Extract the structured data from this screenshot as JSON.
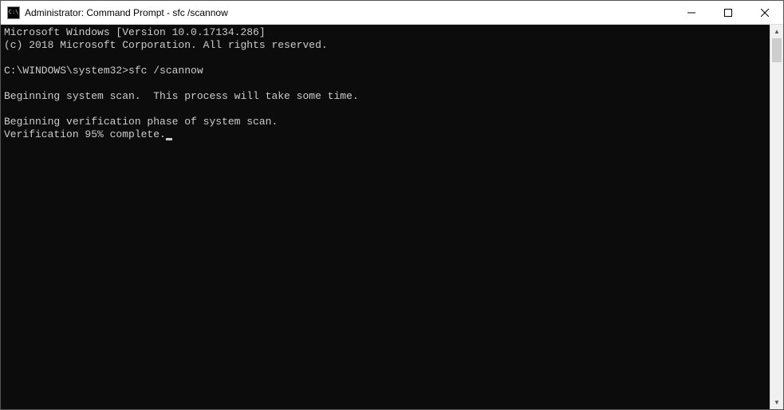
{
  "window": {
    "title": "Administrator: Command Prompt - sfc  /scannow",
    "icon_label": "C:\\"
  },
  "console": {
    "lines": [
      "Microsoft Windows [Version 10.0.17134.286]",
      "(c) 2018 Microsoft Corporation. All rights reserved.",
      "",
      "C:\\WINDOWS\\system32>sfc /scannow",
      "",
      "Beginning system scan.  This process will take some time.",
      "",
      "Beginning verification phase of system scan.",
      "Verification 95% complete."
    ]
  },
  "controls": {
    "minimize": "minimize",
    "maximize": "maximize",
    "close": "close"
  }
}
